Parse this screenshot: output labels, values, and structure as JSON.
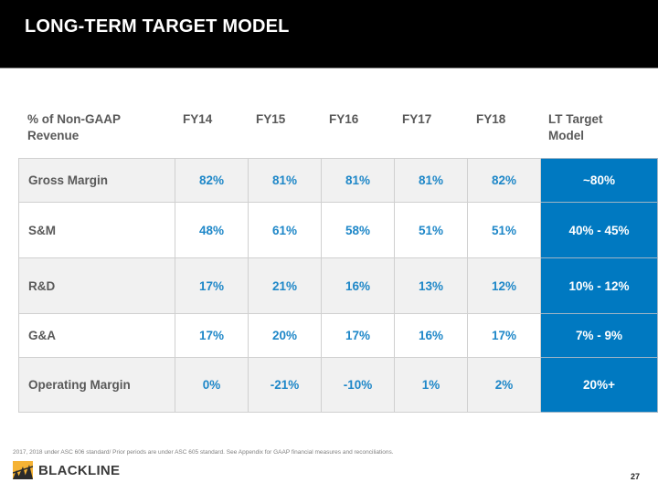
{
  "header": {
    "title": "LONG-TERM TARGET MODEL"
  },
  "table": {
    "row_header_label": [
      "% of Non-GAAP",
      "Revenue"
    ],
    "columns": [
      "FY14",
      "FY15",
      "FY16",
      "FY17",
      "FY18"
    ],
    "target_header": [
      "LT Target",
      "Model"
    ],
    "rows": [
      {
        "label": "Gross Margin",
        "values": [
          "82%",
          "81%",
          "81%",
          "81%",
          "82%"
        ],
        "target": "~80%"
      },
      {
        "label": "S&M",
        "values": [
          "48%",
          "61%",
          "58%",
          "51%",
          "51%"
        ],
        "target": "40% - 45%"
      },
      {
        "label": "R&D",
        "values": [
          "17%",
          "21%",
          "16%",
          "13%",
          "12%"
        ],
        "target": "10% - 12%"
      },
      {
        "label": "G&A",
        "values": [
          "17%",
          "20%",
          "17%",
          "16%",
          "17%"
        ],
        "target": "7% - 9%"
      },
      {
        "label": "Operating Margin",
        "values": [
          "0%",
          "-21%",
          "-10%",
          "1%",
          "2%"
        ],
        "target": "20%+"
      }
    ]
  },
  "footer": {
    "footnote": "2017, 2018 under ASC 606 standard/ Prior periods are under ASC 605 standard. See Appendix for GAAP financial measures and reconciliations.",
    "logo_text": "BLACKLINE",
    "page_number": "27"
  },
  "colors": {
    "accent": "#0079c1",
    "value_text": "#1e87c8",
    "logo_gold": "#f5b335"
  }
}
